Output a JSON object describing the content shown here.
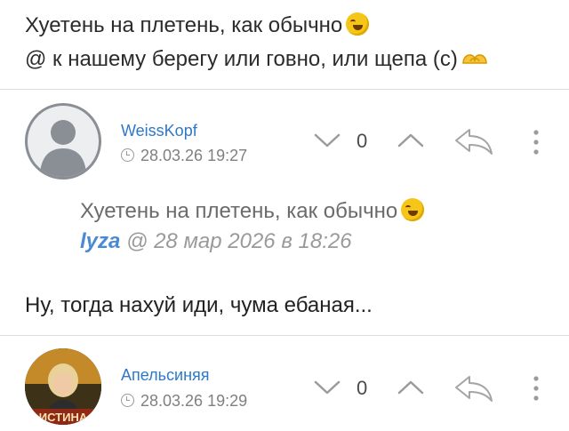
{
  "top_post": {
    "line1": "Хуетень на плетень, как обычно",
    "line2": "@ к нашему берегу или говно, или щепа (с)",
    "line1_emoji": "rolling-on-floor-laughing-emoji",
    "line2_emoji": "heart-hands-emoji"
  },
  "comments": [
    {
      "username": "WeissKopf",
      "datetime": "28.03.26 19:27",
      "vote_count": "0",
      "avatar": "default-user-silhouette",
      "quote": {
        "text": "Хуетень на плетень, как обычно",
        "author": "lyza",
        "meta": " @ 28 мар 2026 в 18:26"
      },
      "body": "Ну, тогда нахуй иди, чума ебаная..."
    },
    {
      "username": "Апельсиняя",
      "datetime": "28.03.26 19:29",
      "vote_count": "0",
      "avatar": "user-photo",
      "avatar_badge": "ИСТИНА"
    }
  ],
  "icons": {
    "downvote": "chevron-down-icon",
    "upvote": "chevron-up-icon",
    "reply": "reply-arrow-icon",
    "more": "more-vertical-icon",
    "time": "clock-icon"
  },
  "colors": {
    "username": "#2e78c9",
    "quote_author": "#4a8ad4",
    "muted": "#808080",
    "divider": "#dedede"
  }
}
